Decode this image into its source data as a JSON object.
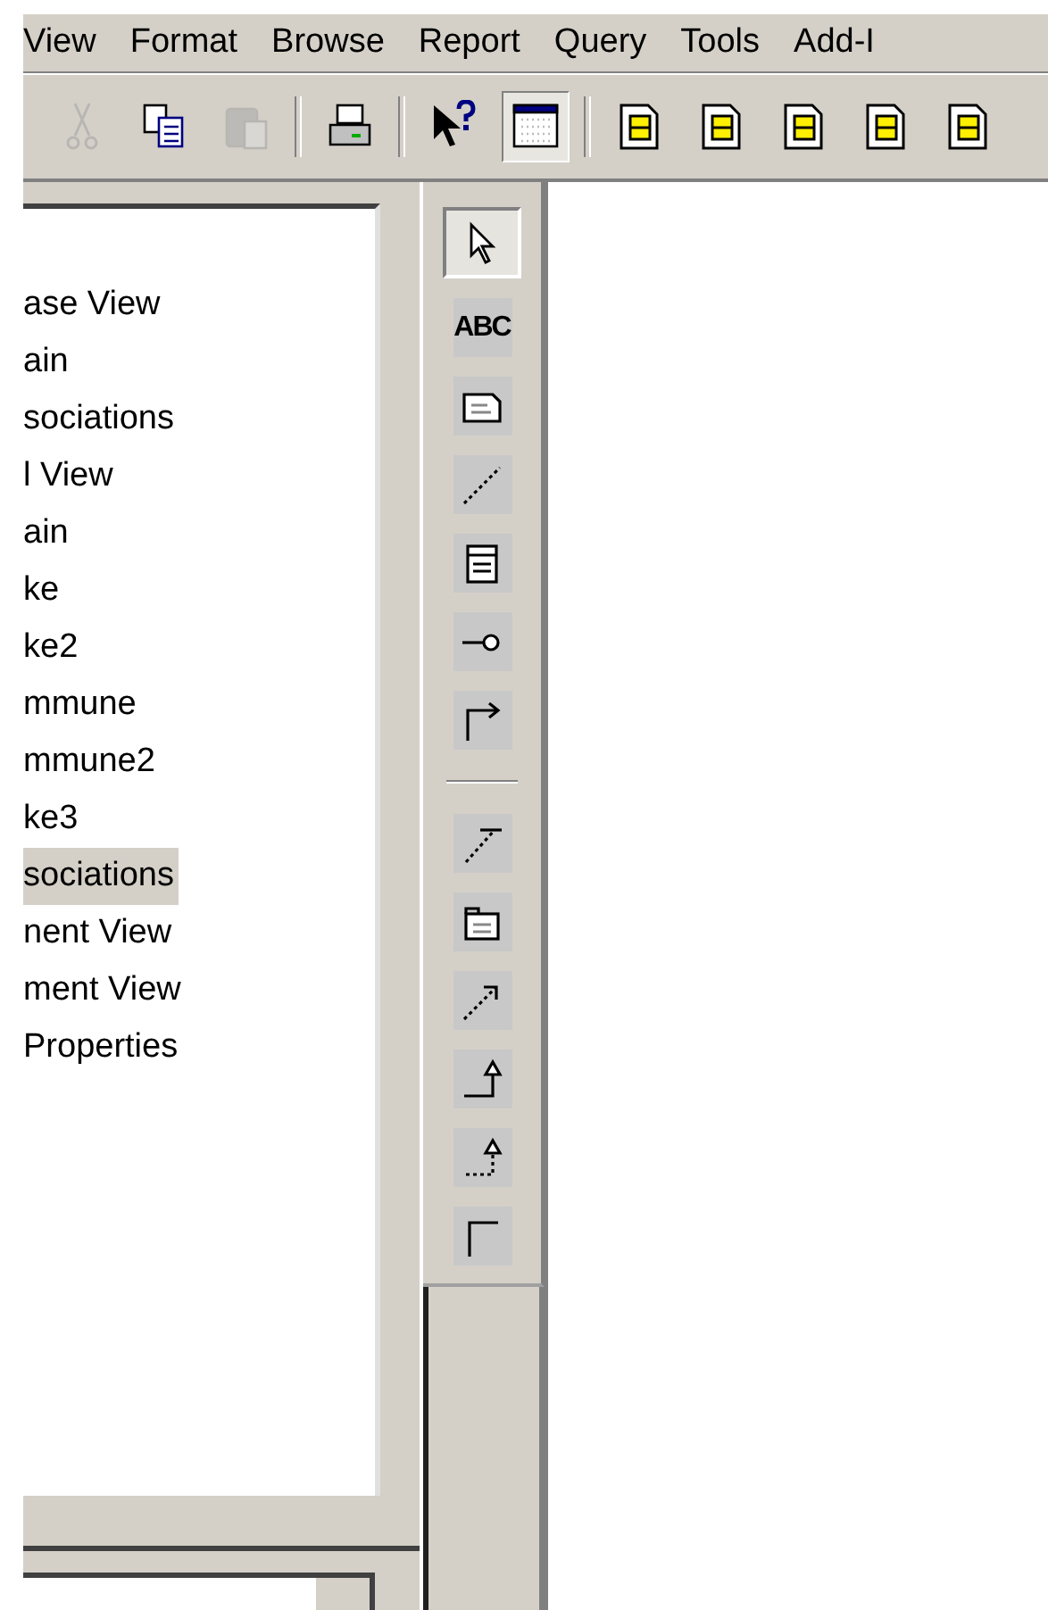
{
  "menu_bar": {
    "items": [
      "View",
      "Format",
      "Browse",
      "Report",
      "Query",
      "Tools",
      "Add-I"
    ]
  },
  "toolbar": {
    "items": [
      {
        "kind": "cut",
        "disabled": true,
        "pressed": false
      },
      {
        "kind": "copy",
        "disabled": false,
        "pressed": false
      },
      {
        "kind": "paste",
        "disabled": true,
        "pressed": false
      },
      {
        "kind": "separator"
      },
      {
        "kind": "print",
        "disabled": false,
        "pressed": false
      },
      {
        "kind": "separator"
      },
      {
        "kind": "help",
        "disabled": false,
        "pressed": false
      },
      {
        "kind": "browser",
        "disabled": false,
        "pressed": true
      },
      {
        "kind": "separator"
      },
      {
        "kind": "diagram-a",
        "disabled": false,
        "pressed": false
      },
      {
        "kind": "diagram-b",
        "disabled": false,
        "pressed": false
      },
      {
        "kind": "diagram-c",
        "disabled": false,
        "pressed": false
      },
      {
        "kind": "diagram-d",
        "disabled": false,
        "pressed": false
      },
      {
        "kind": "diagram-e",
        "disabled": false,
        "pressed": false
      }
    ]
  },
  "browser_tree": {
    "items": [
      {
        "label": "ase View",
        "selected": false
      },
      {
        "label": "ain",
        "selected": false
      },
      {
        "label": "sociations",
        "selected": false
      },
      {
        "label": "l View",
        "selected": false
      },
      {
        "label": "ain",
        "selected": false
      },
      {
        "label": "ke",
        "selected": false
      },
      {
        "label": "ke2",
        "selected": false
      },
      {
        "label": "mmune",
        "selected": false
      },
      {
        "label": "mmune2",
        "selected": false
      },
      {
        "label": "ke3",
        "selected": false
      },
      {
        "label": "sociations",
        "selected": true
      },
      {
        "label": "nent View",
        "selected": false
      },
      {
        "label": "ment View",
        "selected": false
      },
      {
        "label": "Properties",
        "selected": false
      }
    ]
  },
  "tool_palette": {
    "items": [
      {
        "kind": "select",
        "selected": true
      },
      {
        "kind": "text",
        "label": "ABC",
        "selected": false
      },
      {
        "kind": "note",
        "selected": false
      },
      {
        "kind": "anchor",
        "selected": false
      },
      {
        "kind": "class",
        "selected": false
      },
      {
        "kind": "interface",
        "selected": false
      },
      {
        "kind": "association",
        "selected": false
      },
      {
        "kind": "separator"
      },
      {
        "kind": "dashed-bar",
        "selected": false
      },
      {
        "kind": "package",
        "selected": false
      },
      {
        "kind": "dependency",
        "selected": false
      },
      {
        "kind": "generalization",
        "selected": false
      },
      {
        "kind": "realization",
        "selected": false
      },
      {
        "kind": "corner",
        "selected": false
      }
    ]
  }
}
